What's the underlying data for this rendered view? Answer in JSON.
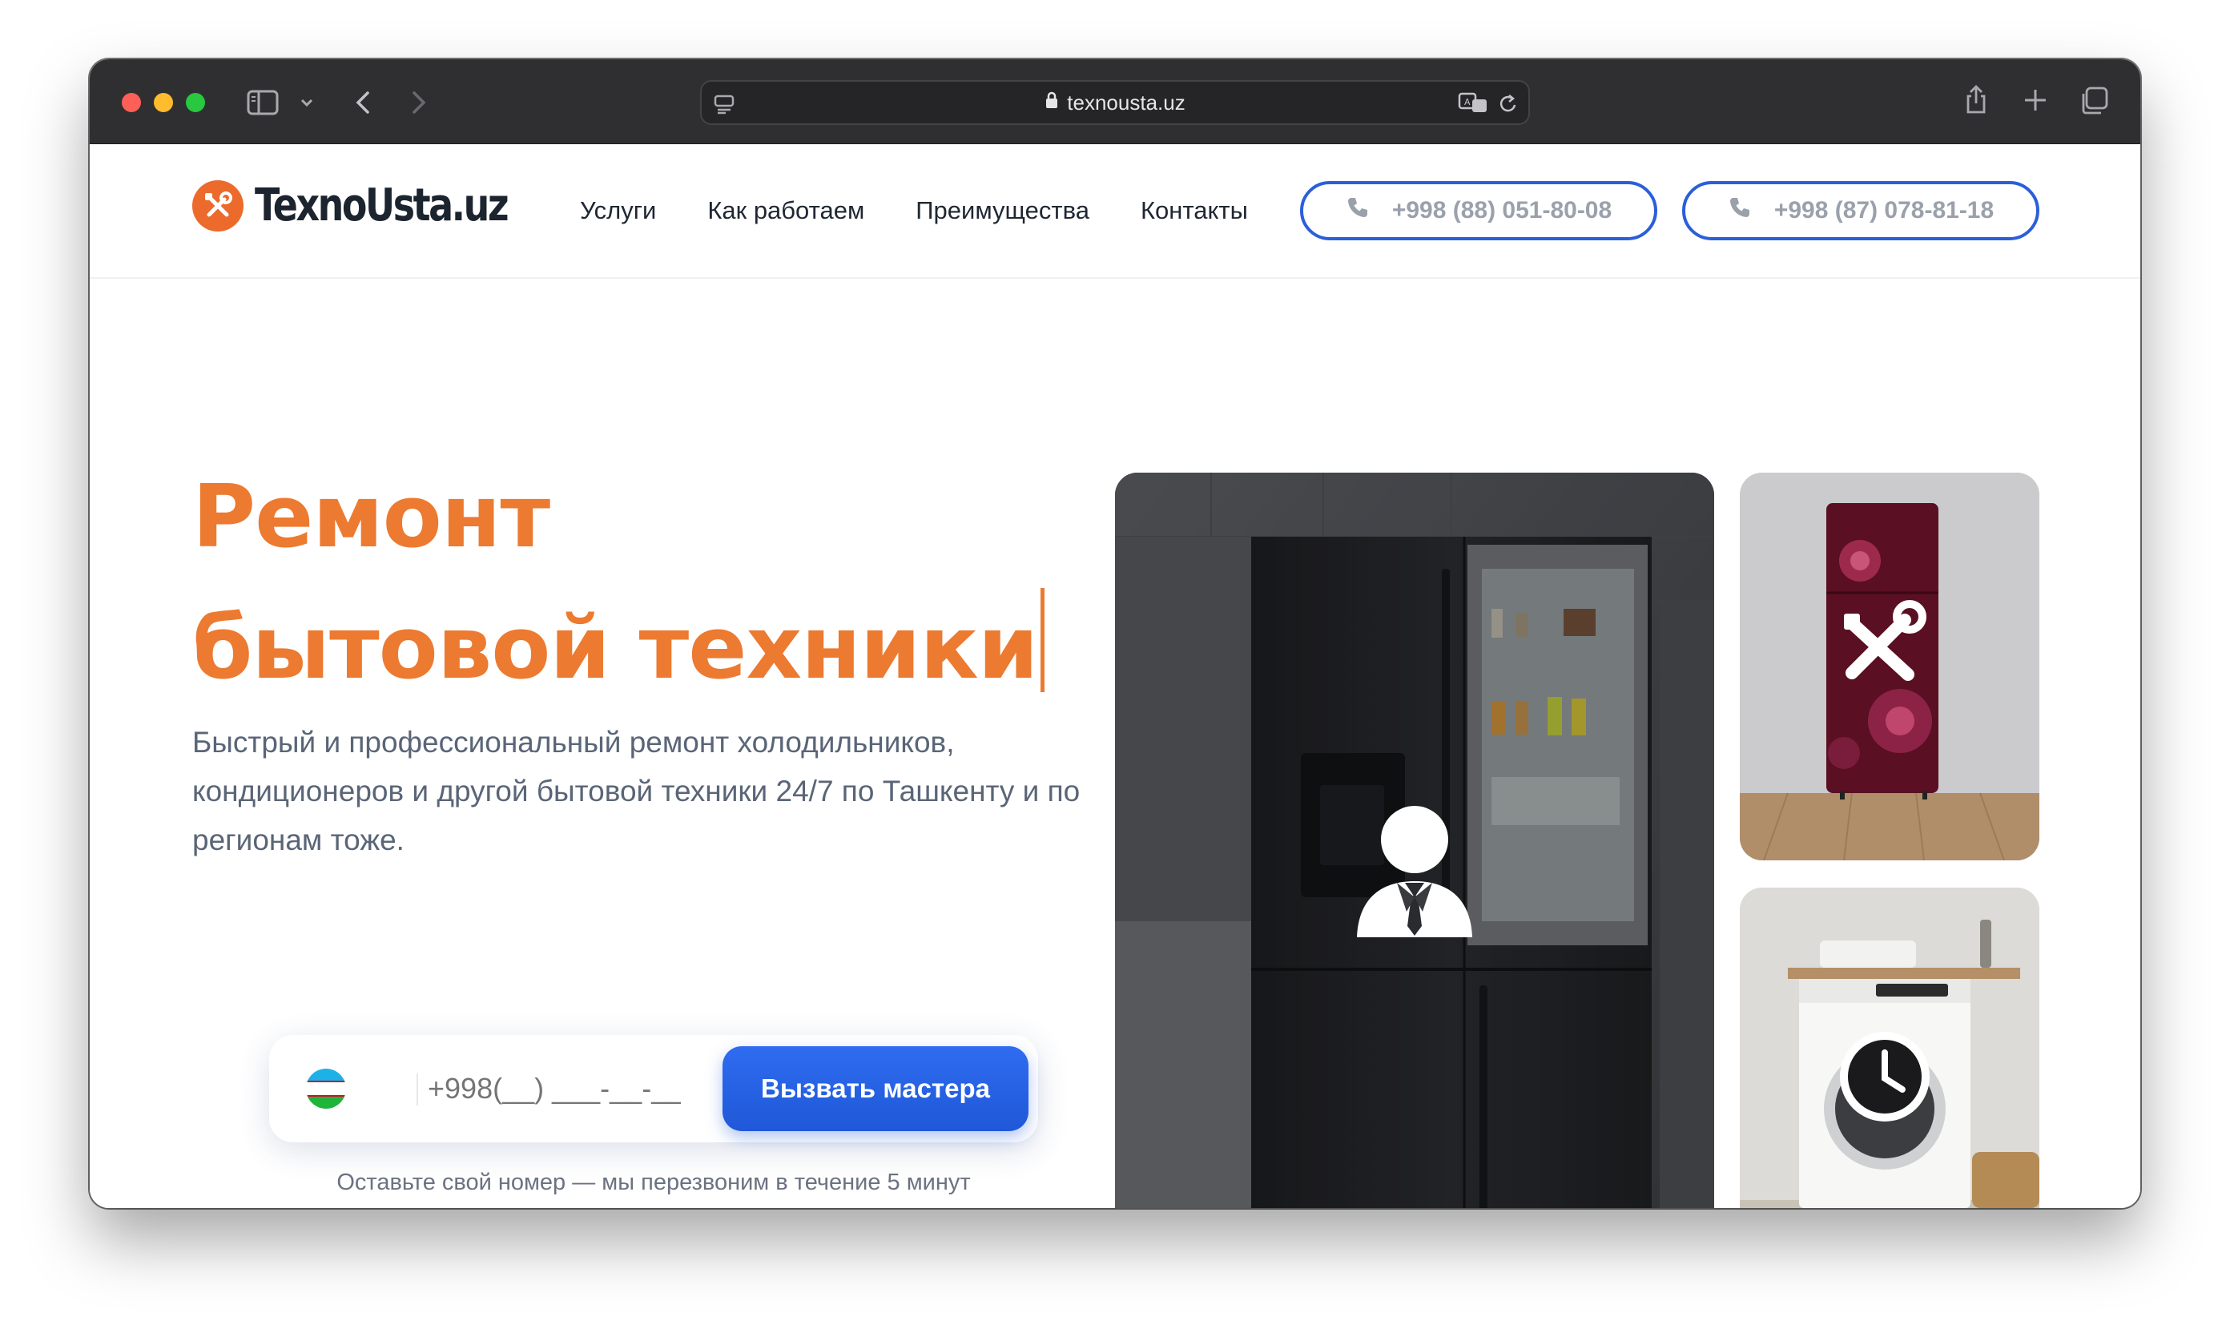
{
  "browser": {
    "url": "texnousta.uz"
  },
  "header": {
    "logo_text": "TexnoUsta.uz",
    "nav": [
      {
        "label": "Услуги"
      },
      {
        "label": "Как работаем"
      },
      {
        "label": "Преимущества"
      },
      {
        "label": "Контакты"
      }
    ],
    "phones": [
      {
        "label": "+998 (88) 051-80-08"
      },
      {
        "label": "+998 (87) 078-81-18"
      }
    ]
  },
  "hero": {
    "title_line1": "Ремонт",
    "title_line2": "бытовой техники",
    "subtitle": "Быстрый и профессиональный ремонт холодильников, кондиционеров и другой бытовой техники 24/7 по Ташкенту и по регионам тоже."
  },
  "callback": {
    "placeholder": "+998(__) ___-__-__",
    "button_label": "Вызвать мастера",
    "note": "Оставьте свой номер — мы перезвоним в течение 5 минут"
  },
  "colors": {
    "accent_orange": "#ec7a30",
    "brand_blue": "#2b5fd9"
  },
  "icons": {
    "tile_big": "worker-icon",
    "tile_top": "tools-icon",
    "tile_bottom": "clock-icon"
  }
}
